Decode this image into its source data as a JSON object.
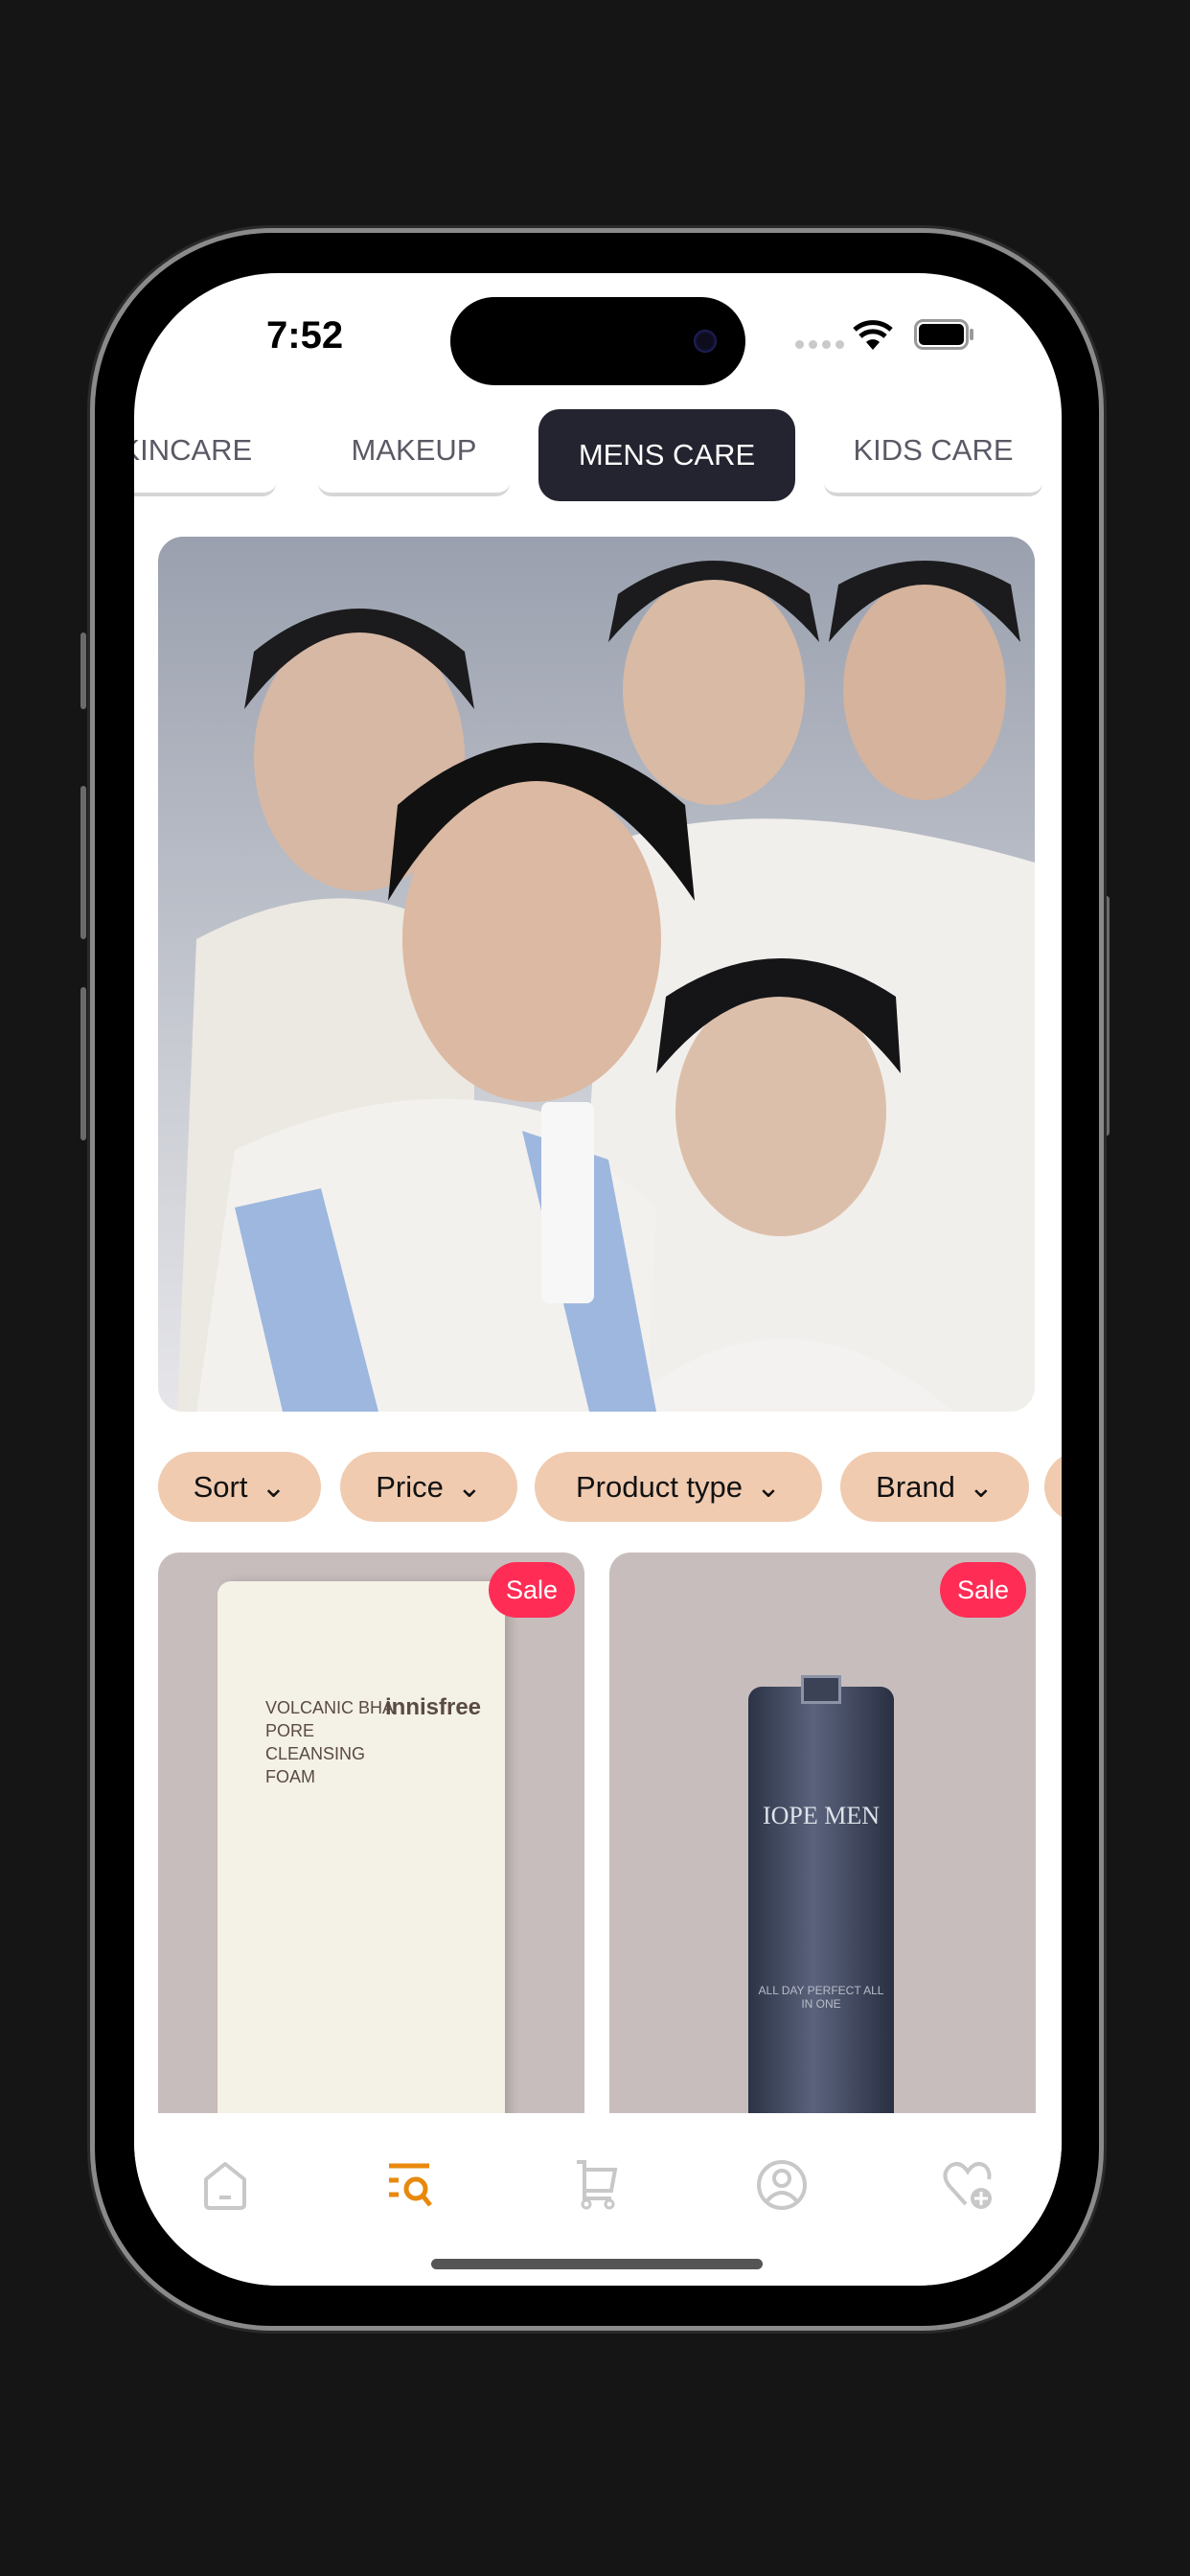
{
  "status_bar": {
    "time": "7:52"
  },
  "categories": [
    {
      "label": "SKINCARE",
      "active": false
    },
    {
      "label": "MAKEUP",
      "active": false
    },
    {
      "label": "MENS CARE",
      "active": true
    },
    {
      "label": "KIDS CARE",
      "active": false
    }
  ],
  "filters": [
    {
      "label": "Sort"
    },
    {
      "label": "Price"
    },
    {
      "label": "Product type"
    },
    {
      "label": "Brand"
    }
  ],
  "products": [
    {
      "badge": "Sale",
      "brand": "innisfree",
      "name": "VOLCANIC BHA PORE CLEANSING FOAM"
    },
    {
      "badge": "Sale",
      "brand": "IOPE MEN",
      "name": "ALL DAY PERFECT ALL IN ONE"
    }
  ],
  "bottom_nav": [
    {
      "icon": "home-icon",
      "active": false
    },
    {
      "icon": "search-list-icon",
      "active": true
    },
    {
      "icon": "cart-icon",
      "active": false
    },
    {
      "icon": "profile-icon",
      "active": false
    },
    {
      "icon": "heart-plus-icon",
      "active": false
    }
  ],
  "colors": {
    "accent": "#e8890c",
    "chip": "#f0cbb0",
    "sale": "#ff2d55",
    "active_tab": "#242430",
    "inactive_icon": "#c8c8c8"
  }
}
